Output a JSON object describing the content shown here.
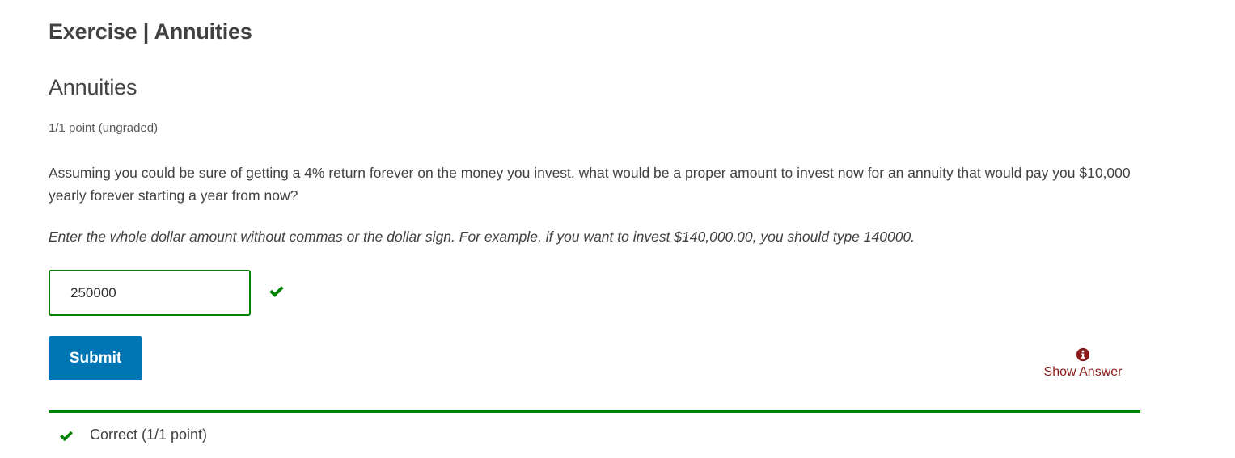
{
  "header": {
    "title": "Exercise | Annuities"
  },
  "problem": {
    "title": "Annuities",
    "points": "1/1 point (ungraded)",
    "question": "Assuming you could be sure of getting a 4% return forever on the money you invest, what would be a proper amount to invest now for an annuity that would pay you $10,000 yearly forever starting a year from now?",
    "instruction": "Enter the whole dollar amount without commas or the dollar sign. For example, if you want to invest $140,000.00, you should type 140000.",
    "answer_value": "250000",
    "answer_status_icon": "checkmark-icon"
  },
  "actions": {
    "submit_label": "Submit",
    "show_answer_label": "Show Answer",
    "show_answer_icon": "info-circle-icon"
  },
  "feedback": {
    "icon": "checkmark-icon",
    "text": "Correct (1/1 point)"
  },
  "colors": {
    "correct_green": "#008100",
    "submit_blue": "#0075b4",
    "show_answer_red": "#8b1a1a",
    "text": "#414141"
  }
}
